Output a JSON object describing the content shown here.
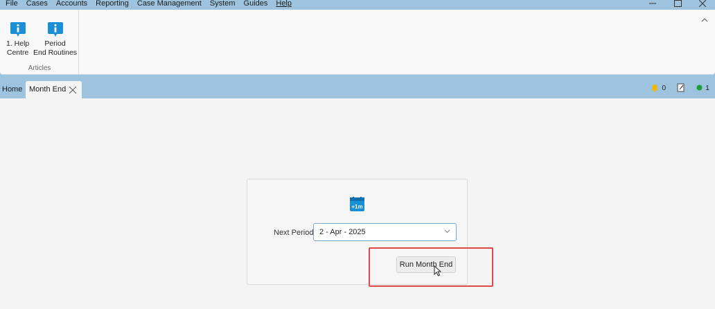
{
  "menu": {
    "items": [
      "File",
      "Cases",
      "Accounts",
      "Reporting",
      "Case Management",
      "System",
      "Guides",
      "Help"
    ],
    "active": "Help"
  },
  "ribbon": {
    "buttons": [
      {
        "label": "1. Help\nCentre",
        "icon": "info-icon"
      },
      {
        "label": "Period\nEnd Routines",
        "icon": "info-icon"
      }
    ],
    "group_label": "Articles"
  },
  "tabs": {
    "home_label": "Home",
    "active_label": "Month End"
  },
  "status": {
    "notifications_count": "0",
    "online_count": "1",
    "colors": {
      "bell": "#f2b800",
      "online": "#1e9e3a"
    }
  },
  "month_end": {
    "icon_text": "+1m",
    "next_period_label": "Next Period:",
    "next_period_value": "2 - Apr - 2025",
    "run_button_label": "Run Month End"
  },
  "colors": {
    "chrome": "#9dc3df",
    "accent": "#1a8fd6",
    "highlight": "#e04848"
  }
}
